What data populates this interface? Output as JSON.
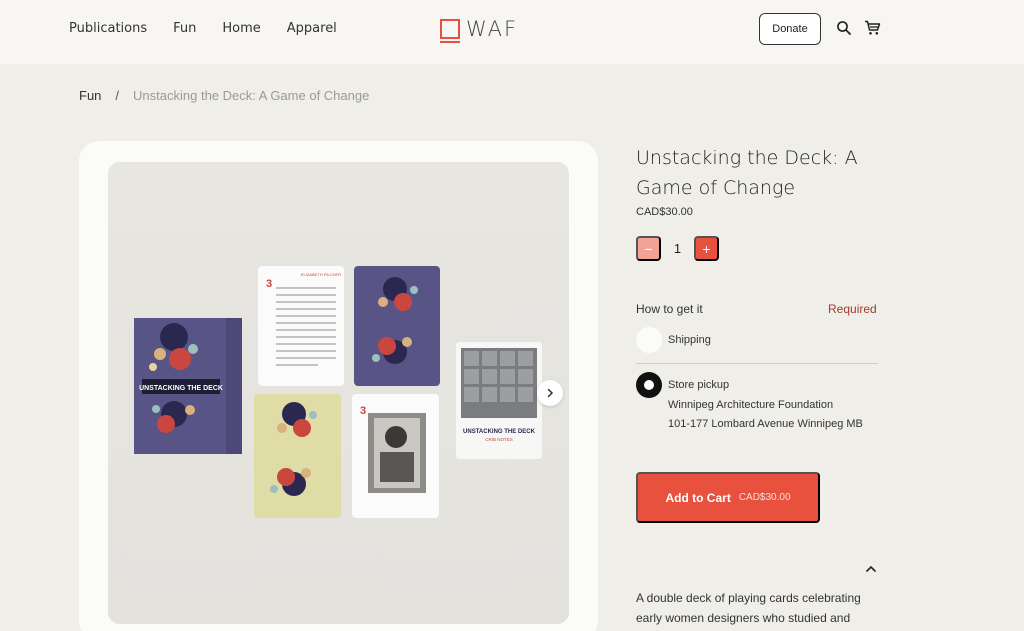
{
  "nav": {
    "items": [
      {
        "label": "Publications"
      },
      {
        "label": "Fun"
      },
      {
        "label": "Home"
      },
      {
        "label": "Apparel"
      }
    ]
  },
  "logo": {
    "text": "WAF"
  },
  "header": {
    "donate_label": "Donate",
    "search_icon": "search-icon",
    "cart_icon": "cart-icon"
  },
  "breadcrumb": {
    "parent": "Fun",
    "separator": "/",
    "current": "Unstacking the Deck: A Game of Change"
  },
  "gallery": {
    "image_alt": "Playing card deck boxes and cards",
    "next_icon": "chevron-right-icon",
    "box_title": "UNSTACKING THE DECK",
    "card_rank": "3",
    "notes_title": "UNSTACKING THE DECK",
    "notes_subtitle": "CRIB NOTES",
    "card_heading": "ELIZABETH PILCHER"
  },
  "product": {
    "title": "Unstacking the Deck: A Game of Change",
    "price": "CAD$30.00",
    "quantity": "1",
    "minus_label": "−",
    "plus_label": "+"
  },
  "fulfillment": {
    "label": "How to get it",
    "required": "Required",
    "options": [
      {
        "label": "Shipping",
        "selected": false
      },
      {
        "label": "Store pickup",
        "selected": true,
        "location": "Winnipeg Architecture Foundation",
        "address": "101-177 Lombard Avenue Winnipeg MB"
      }
    ]
  },
  "cart": {
    "label": "Add to Cart",
    "amount": "CAD$30.00"
  },
  "description": {
    "text": "A double deck of playing cards celebrating early women designers who studied and"
  },
  "colors": {
    "accent": "#e9513f",
    "accent_light": "#f2a396",
    "required": "#a63a2e",
    "background": "#efeee9"
  }
}
